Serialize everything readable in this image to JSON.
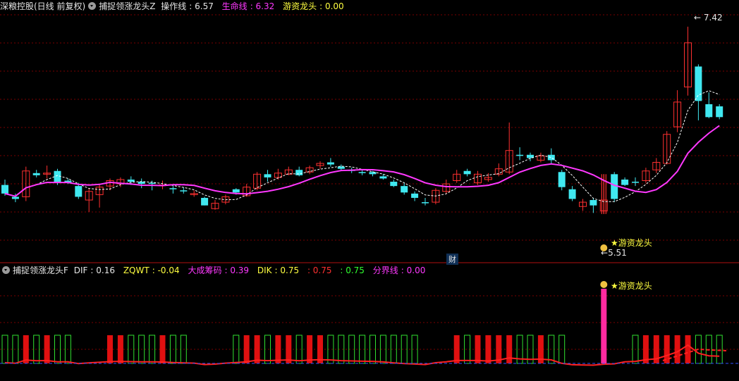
{
  "top_header": {
    "stock": "深粮控股(日线 前复权)",
    "indicator": "捕捉领涨龙头Z",
    "items": [
      {
        "label": "操作线",
        "value": "6.57",
        "color": "#e6e6e6"
      },
      {
        "label": "生命线",
        "value": "6.32",
        "color": "#ff38ff"
      },
      {
        "label": "游资龙头",
        "value": "0.00",
        "color": "#ffff40"
      }
    ]
  },
  "bottom_header": {
    "indicator": "捕捉领涨龙头F",
    "items": [
      {
        "label": "DIF",
        "value": "0.16",
        "color": "#e6e6e6"
      },
      {
        "label": "ZQWT",
        "value": "-0.04",
        "color": "#ffff40"
      },
      {
        "label": "大成筹码",
        "value": "0.39",
        "color": "#ff38ff"
      },
      {
        "label": "DIK",
        "value": "0.75",
        "color": "#ffff40"
      },
      {
        "label": "",
        "value": "0.75",
        "color": "#ff3030"
      },
      {
        "label": "",
        "value": "0.75",
        "color": "#30ff30"
      },
      {
        "label": "分界线",
        "value": "0.00",
        "color": "#ff38ff"
      }
    ]
  },
  "annotations": {
    "high_label": "7.42",
    "low_label": "5.51",
    "signal_label": "游资龙头",
    "signal_label_bottom": "游资龙头",
    "finance_tag": "财"
  },
  "colors": {
    "up": "#ff3030",
    "down": "#40e8f0",
    "ma": "#ff38ff",
    "dash": "#ffffff",
    "grid": "#7a0000"
  },
  "chart_data": {
    "type": "candlestick",
    "price_range": [
      5.3,
      7.55
    ],
    "candles": [
      [
        5.95,
        5.87,
        6.0,
        5.85
      ],
      [
        5.84,
        5.82,
        5.87,
        5.79
      ],
      [
        5.84,
        6.08,
        6.12,
        5.8
      ],
      [
        6.06,
        6.04,
        6.09,
        6.02
      ],
      [
        6.05,
        6.06,
        6.13,
        6.01
      ],
      [
        6.08,
        5.97,
        6.1,
        5.95
      ],
      [
        5.99,
        5.97,
        6.01,
        5.96
      ],
      [
        5.94,
        5.84,
        5.97,
        5.82
      ],
      [
        5.81,
        5.89,
        5.92,
        5.7
      ],
      [
        5.86,
        5.93,
        5.96,
        5.74
      ],
      [
        5.94,
        5.99,
        6.01,
        5.9
      ],
      [
        5.96,
        6.0,
        6.02,
        5.93
      ],
      [
        6.0,
        5.98,
        6.03,
        5.95
      ],
      [
        5.98,
        5.96,
        6.01,
        5.92
      ],
      [
        5.97,
        5.96,
        5.99,
        5.9
      ],
      [
        5.95,
        5.95,
        5.99,
        5.91
      ],
      [
        5.92,
        5.91,
        5.94,
        5.87
      ],
      [
        5.9,
        5.89,
        5.93,
        5.87
      ],
      [
        5.86,
        5.87,
        5.9,
        5.84
      ],
      [
        5.83,
        5.76,
        5.84,
        5.76
      ],
      [
        5.73,
        5.78,
        5.81,
        5.72
      ],
      [
        5.79,
        5.84,
        5.86,
        5.77
      ],
      [
        5.91,
        5.88,
        5.92,
        5.86
      ],
      [
        5.85,
        5.93,
        5.96,
        5.84
      ],
      [
        5.92,
        6.05,
        6.07,
        5.9
      ],
      [
        6.05,
        6.02,
        6.09,
        5.98
      ],
      [
        6.02,
        6.06,
        6.1,
        6.0
      ],
      [
        6.05,
        6.09,
        6.12,
        6.04
      ],
      [
        6.09,
        6.04,
        6.12,
        6.03
      ],
      [
        6.07,
        6.11,
        6.13,
        6.05
      ],
      [
        6.13,
        6.15,
        6.17,
        6.1
      ],
      [
        6.16,
        6.14,
        6.2,
        6.12
      ],
      [
        6.12,
        6.1,
        6.14,
        6.08
      ],
      [
        6.09,
        6.08,
        6.11,
        6.06
      ],
      [
        6.07,
        6.06,
        6.09,
        6.04
      ],
      [
        6.07,
        6.05,
        6.08,
        6.03
      ],
      [
        6.03,
        6.01,
        6.05,
        6.0
      ],
      [
        5.98,
        5.94,
        6.0,
        5.93
      ],
      [
        5.94,
        5.88,
        5.97,
        5.86
      ],
      [
        5.87,
        5.83,
        5.89,
        5.8
      ],
      [
        5.79,
        5.78,
        5.83,
        5.76
      ],
      [
        5.79,
        5.9,
        5.92,
        5.77
      ],
      [
        5.89,
        5.96,
        6.0,
        5.87
      ],
      [
        5.99,
        6.05,
        6.09,
        5.97
      ],
      [
        6.08,
        6.05,
        6.1,
        6.03
      ],
      [
        5.97,
        6.05,
        6.08,
        5.95
      ],
      [
        6.0,
        6.02,
        6.06,
        5.98
      ],
      [
        6.05,
        6.1,
        6.15,
        6.03
      ],
      [
        6.07,
        6.27,
        6.53,
        6.05
      ],
      [
        6.23,
        6.22,
        6.3,
        6.18
      ],
      [
        6.23,
        6.2,
        6.25,
        6.17
      ],
      [
        6.18,
        6.22,
        6.25,
        6.16
      ],
      [
        6.23,
        6.18,
        6.29,
        6.15
      ],
      [
        6.07,
        5.93,
        6.09,
        5.9
      ],
      [
        5.91,
        5.82,
        5.94,
        5.8
      ],
      [
        5.75,
        5.79,
        5.82,
        5.71
      ],
      [
        5.81,
        5.76,
        5.83,
        5.69
      ],
      [
        5.71,
        5.81,
        6.05,
        5.68
      ],
      [
        6.05,
        5.82,
        6.07,
        5.79
      ],
      [
        6.0,
        5.95,
        6.02,
        5.94
      ],
      [
        5.98,
        5.97,
        6.02,
        5.94
      ],
      [
        5.99,
        6.08,
        6.11,
        5.97
      ],
      [
        6.09,
        6.16,
        6.2,
        6.06
      ],
      [
        6.15,
        6.42,
        6.45,
        6.14
      ],
      [
        6.49,
        6.72,
        6.83,
        6.44
      ],
      [
        6.86,
        7.27,
        7.42,
        6.78
      ],
      [
        7.05,
        6.73,
        7.07,
        6.55
      ],
      [
        6.7,
        6.58,
        6.81,
        6.57
      ],
      [
        6.68,
        6.58,
        6.7,
        6.56
      ]
    ]
  }
}
